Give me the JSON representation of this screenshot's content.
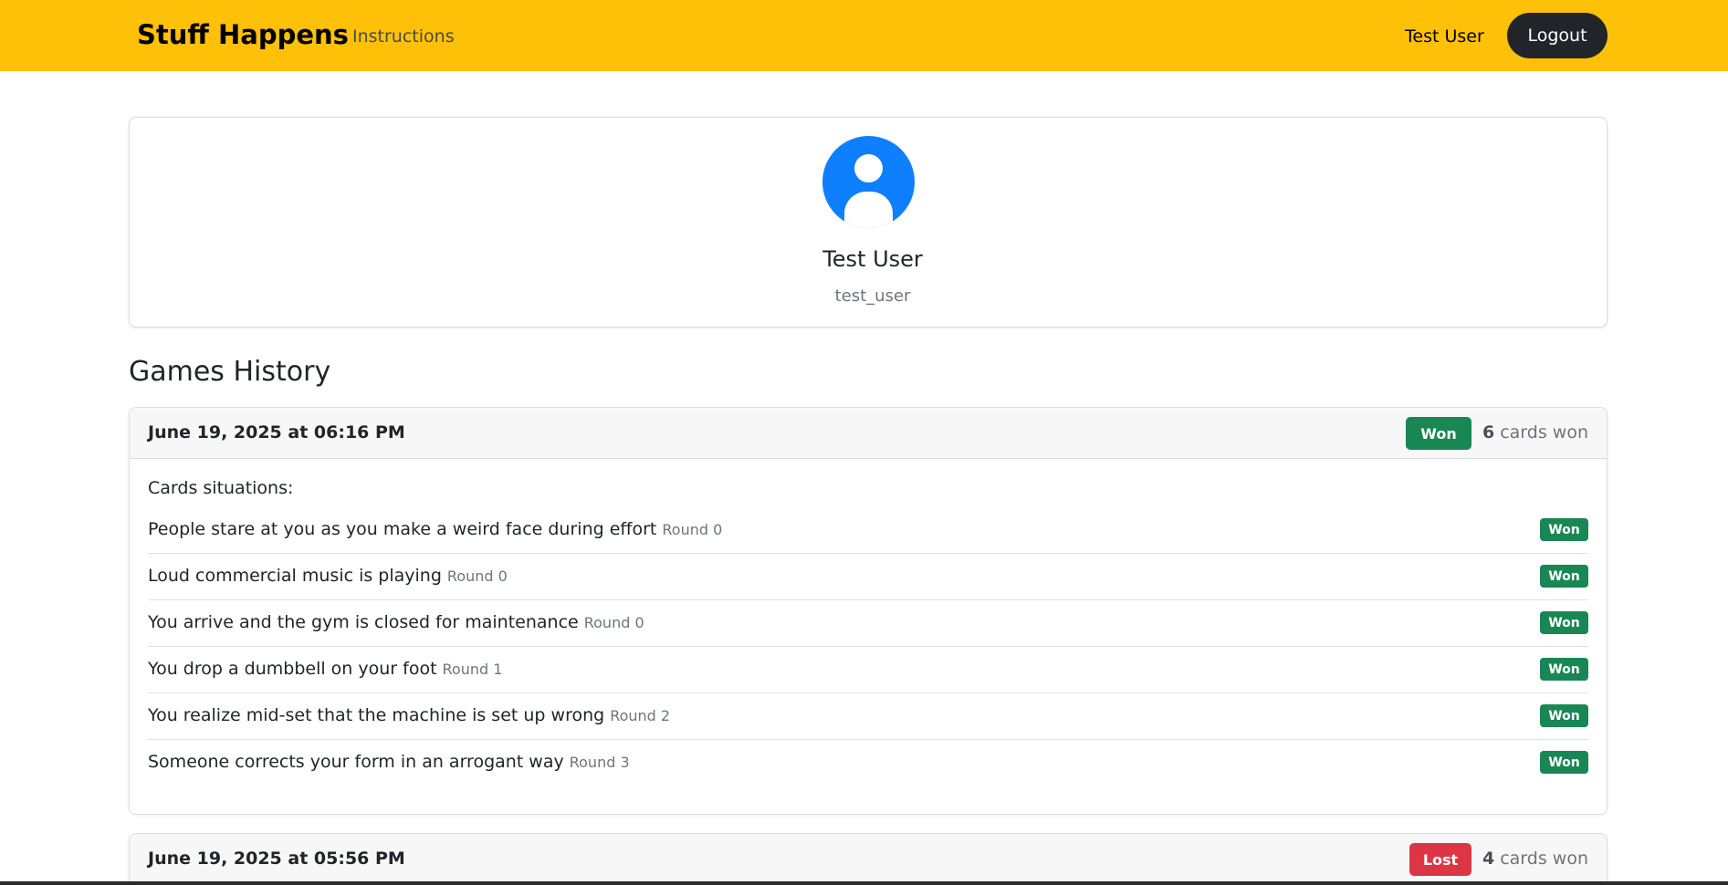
{
  "navbar": {
    "brand": "Stuff Happens",
    "instructions_link": "Instructions",
    "user_name": "Test User",
    "logout_label": "Logout"
  },
  "profile": {
    "avatar_icon": "person-circle-icon",
    "name": "Test User",
    "username": "test_user"
  },
  "history": {
    "title": "Games History",
    "games": [
      {
        "date": "June 19, 2025 at 06:16 PM",
        "result": "Won",
        "cards_won_count": "6",
        "cards_won_suffix": "cards won",
        "cards_label": "Cards situations:",
        "cards": [
          {
            "text": "People stare at you as you make a weird face during effort",
            "round": "Round 0",
            "status": "Won"
          },
          {
            "text": "Loud commercial music is playing",
            "round": "Round 0",
            "status": "Won"
          },
          {
            "text": "You arrive and the gym is closed for maintenance",
            "round": "Round 0",
            "status": "Won"
          },
          {
            "text": "You drop a dumbbell on your foot",
            "round": "Round 1",
            "status": "Won"
          },
          {
            "text": "You realize mid-set that the machine is set up wrong",
            "round": "Round 2",
            "status": "Won"
          },
          {
            "text": "Someone corrects your form in an arrogant way",
            "round": "Round 3",
            "status": "Won"
          }
        ]
      },
      {
        "date": "June 19, 2025 at 05:56 PM",
        "result": "Lost",
        "cards_won_count": "4",
        "cards_won_suffix": "cards won"
      }
    ]
  },
  "colors": {
    "navbar": "#ffc107",
    "won": "#198754",
    "lost": "#dc3545",
    "avatar": "#0d7fff"
  }
}
